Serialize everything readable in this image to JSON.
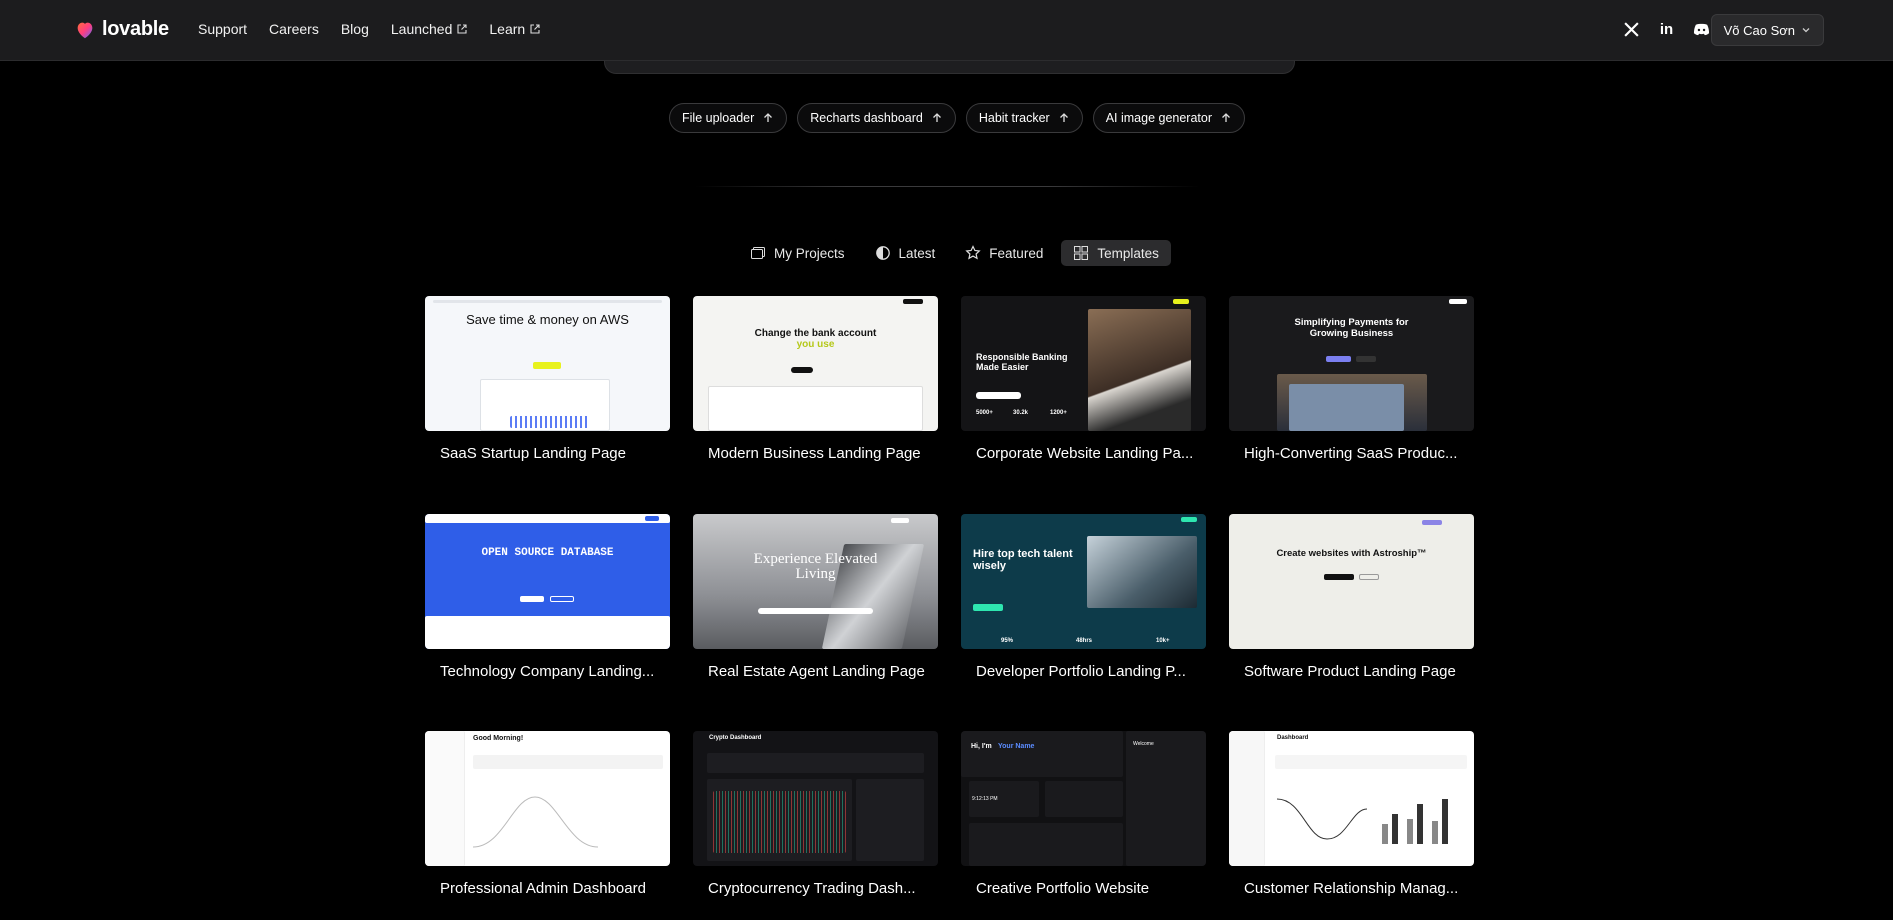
{
  "header": {
    "brand": "lovable",
    "nav": [
      {
        "label": "Support",
        "external": false
      },
      {
        "label": "Careers",
        "external": false
      },
      {
        "label": "Blog",
        "external": false
      },
      {
        "label": "Launched",
        "external": true
      },
      {
        "label": "Learn",
        "external": true
      }
    ],
    "social": [
      "x-icon",
      "linkedin-icon",
      "discord-icon"
    ],
    "user_name": "Võ Cao Sơn"
  },
  "suggestions": [
    "File uploader",
    "Recharts dashboard",
    "Habit tracker",
    "AI image generator"
  ],
  "tabs": [
    {
      "label": "My Projects",
      "icon": "folder-icon",
      "active": false
    },
    {
      "label": "Latest",
      "icon": "clock-icon",
      "active": false
    },
    {
      "label": "Featured",
      "icon": "star-icon",
      "active": false
    },
    {
      "label": "Templates",
      "icon": "grid-icon",
      "active": true
    }
  ],
  "templates": [
    {
      "title": "SaaS Startup Landing Page",
      "thumb_heading": "Save time & money on AWS"
    },
    {
      "title": "Modern Business Landing Page",
      "thumb_heading": "Change the bank account",
      "thumb_accent": "you use"
    },
    {
      "title": "Corporate Website Landing Pa...",
      "thumb_heading": "Responsible Banking Made Easier",
      "thumb_stats": [
        "5000+",
        "30.2k",
        "1200+"
      ]
    },
    {
      "title": "High-Converting SaaS Produc...",
      "thumb_heading": "Simplifying Payments for Growing Business"
    },
    {
      "title": "Technology Company Landing...",
      "thumb_heading": "OPEN SOURCE DATABASE"
    },
    {
      "title": "Real Estate Agent Landing Page",
      "thumb_heading": "Experience Elevated Living"
    },
    {
      "title": "Developer Portfolio Landing P...",
      "thumb_heading": "Hire top tech talent wisely",
      "thumb_stats": [
        "95%",
        "48hrs",
        "10k+"
      ]
    },
    {
      "title": "Software Product Landing Page",
      "thumb_heading": "Create websites with Astroship™"
    },
    {
      "title": "Professional Admin Dashboard",
      "thumb_heading": "Good Morning!"
    },
    {
      "title": "Cryptocurrency Trading Dash...",
      "thumb_heading": "Crypto Dashboard"
    },
    {
      "title": "Creative Portfolio Website",
      "thumb_heading": "Hi, I'm",
      "thumb_accent": "Your Name",
      "thumb_side": "Welcome",
      "thumb_time": "9:12:13 PM"
    },
    {
      "title": "Customer Relationship Manag...",
      "thumb_heading": "Dashboard"
    }
  ]
}
